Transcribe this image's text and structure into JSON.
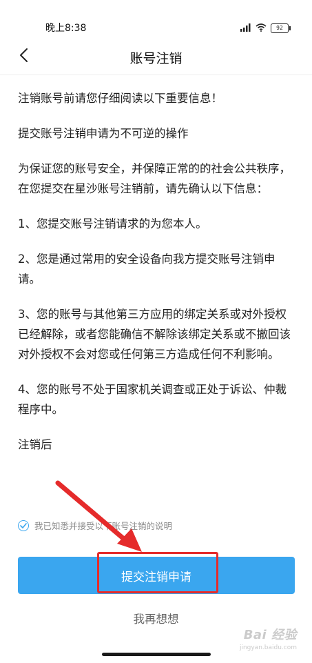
{
  "status_bar": {
    "time": "晚上8:38",
    "battery": "92",
    "icons": [
      "signal-icon",
      "wifi-icon",
      "battery-icon"
    ]
  },
  "nav": {
    "title": "账号注销",
    "back_icon": "chevron-left-icon"
  },
  "content": {
    "paragraphs": [
      "注销账号前请您仔细阅读以下重要信息！",
      "提交账号注销申请为不可逆的操作",
      "为保证您的账号安全，并保障正常的的社会公共秩序，在您提交在星沙账号注销前，请先确认以下信息：",
      "1、您提交账号注销请求的为您本人。",
      "2、您是通过常用的安全设备向我方提交账号注销申请。",
      "3、您的账号与其他第三方应用的绑定关系或对外授权已经解除，或者您能确信不解除该绑定关系或不撤回该对外授权不会对您或任何第三方造成任何不利影响。",
      "4、您的账号不处于国家机关调查或正处于诉讼、仲裁程序中。",
      "注销后"
    ]
  },
  "agreement": {
    "text": "我已知悉并接受以下账号注销的说明",
    "checked": true
  },
  "actions": {
    "submit_label": "提交注销申请",
    "cancel_label": "我再想想"
  },
  "colors": {
    "accent": "#3aa6ef",
    "annotation": "#e52b2b"
  },
  "watermark": {
    "main": "Bai 经验",
    "sub": "jingyan.baidu.com"
  }
}
